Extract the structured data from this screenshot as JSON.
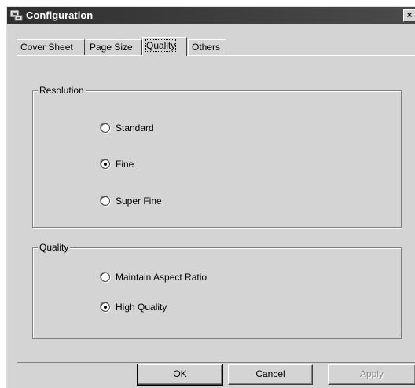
{
  "window": {
    "title": "Configuration",
    "close_label": "×"
  },
  "tabs": [
    {
      "label": "Cover Sheet",
      "active": false
    },
    {
      "label": "Page Size",
      "active": false
    },
    {
      "label": "Quality",
      "active": true
    },
    {
      "label": "Others",
      "active": false
    }
  ],
  "resolution": {
    "legend": "Resolution",
    "options": [
      {
        "label": "Standard",
        "checked": false
      },
      {
        "label": "Fine",
        "checked": true
      },
      {
        "label": "Super Fine",
        "checked": false
      }
    ]
  },
  "quality": {
    "legend": "Quality",
    "options": [
      {
        "label": "Maintain Aspect Ratio",
        "checked": false
      },
      {
        "label": "High Quality",
        "checked": true
      }
    ]
  },
  "buttons": {
    "ok": "OK",
    "cancel": "Cancel",
    "apply": "Apply"
  }
}
